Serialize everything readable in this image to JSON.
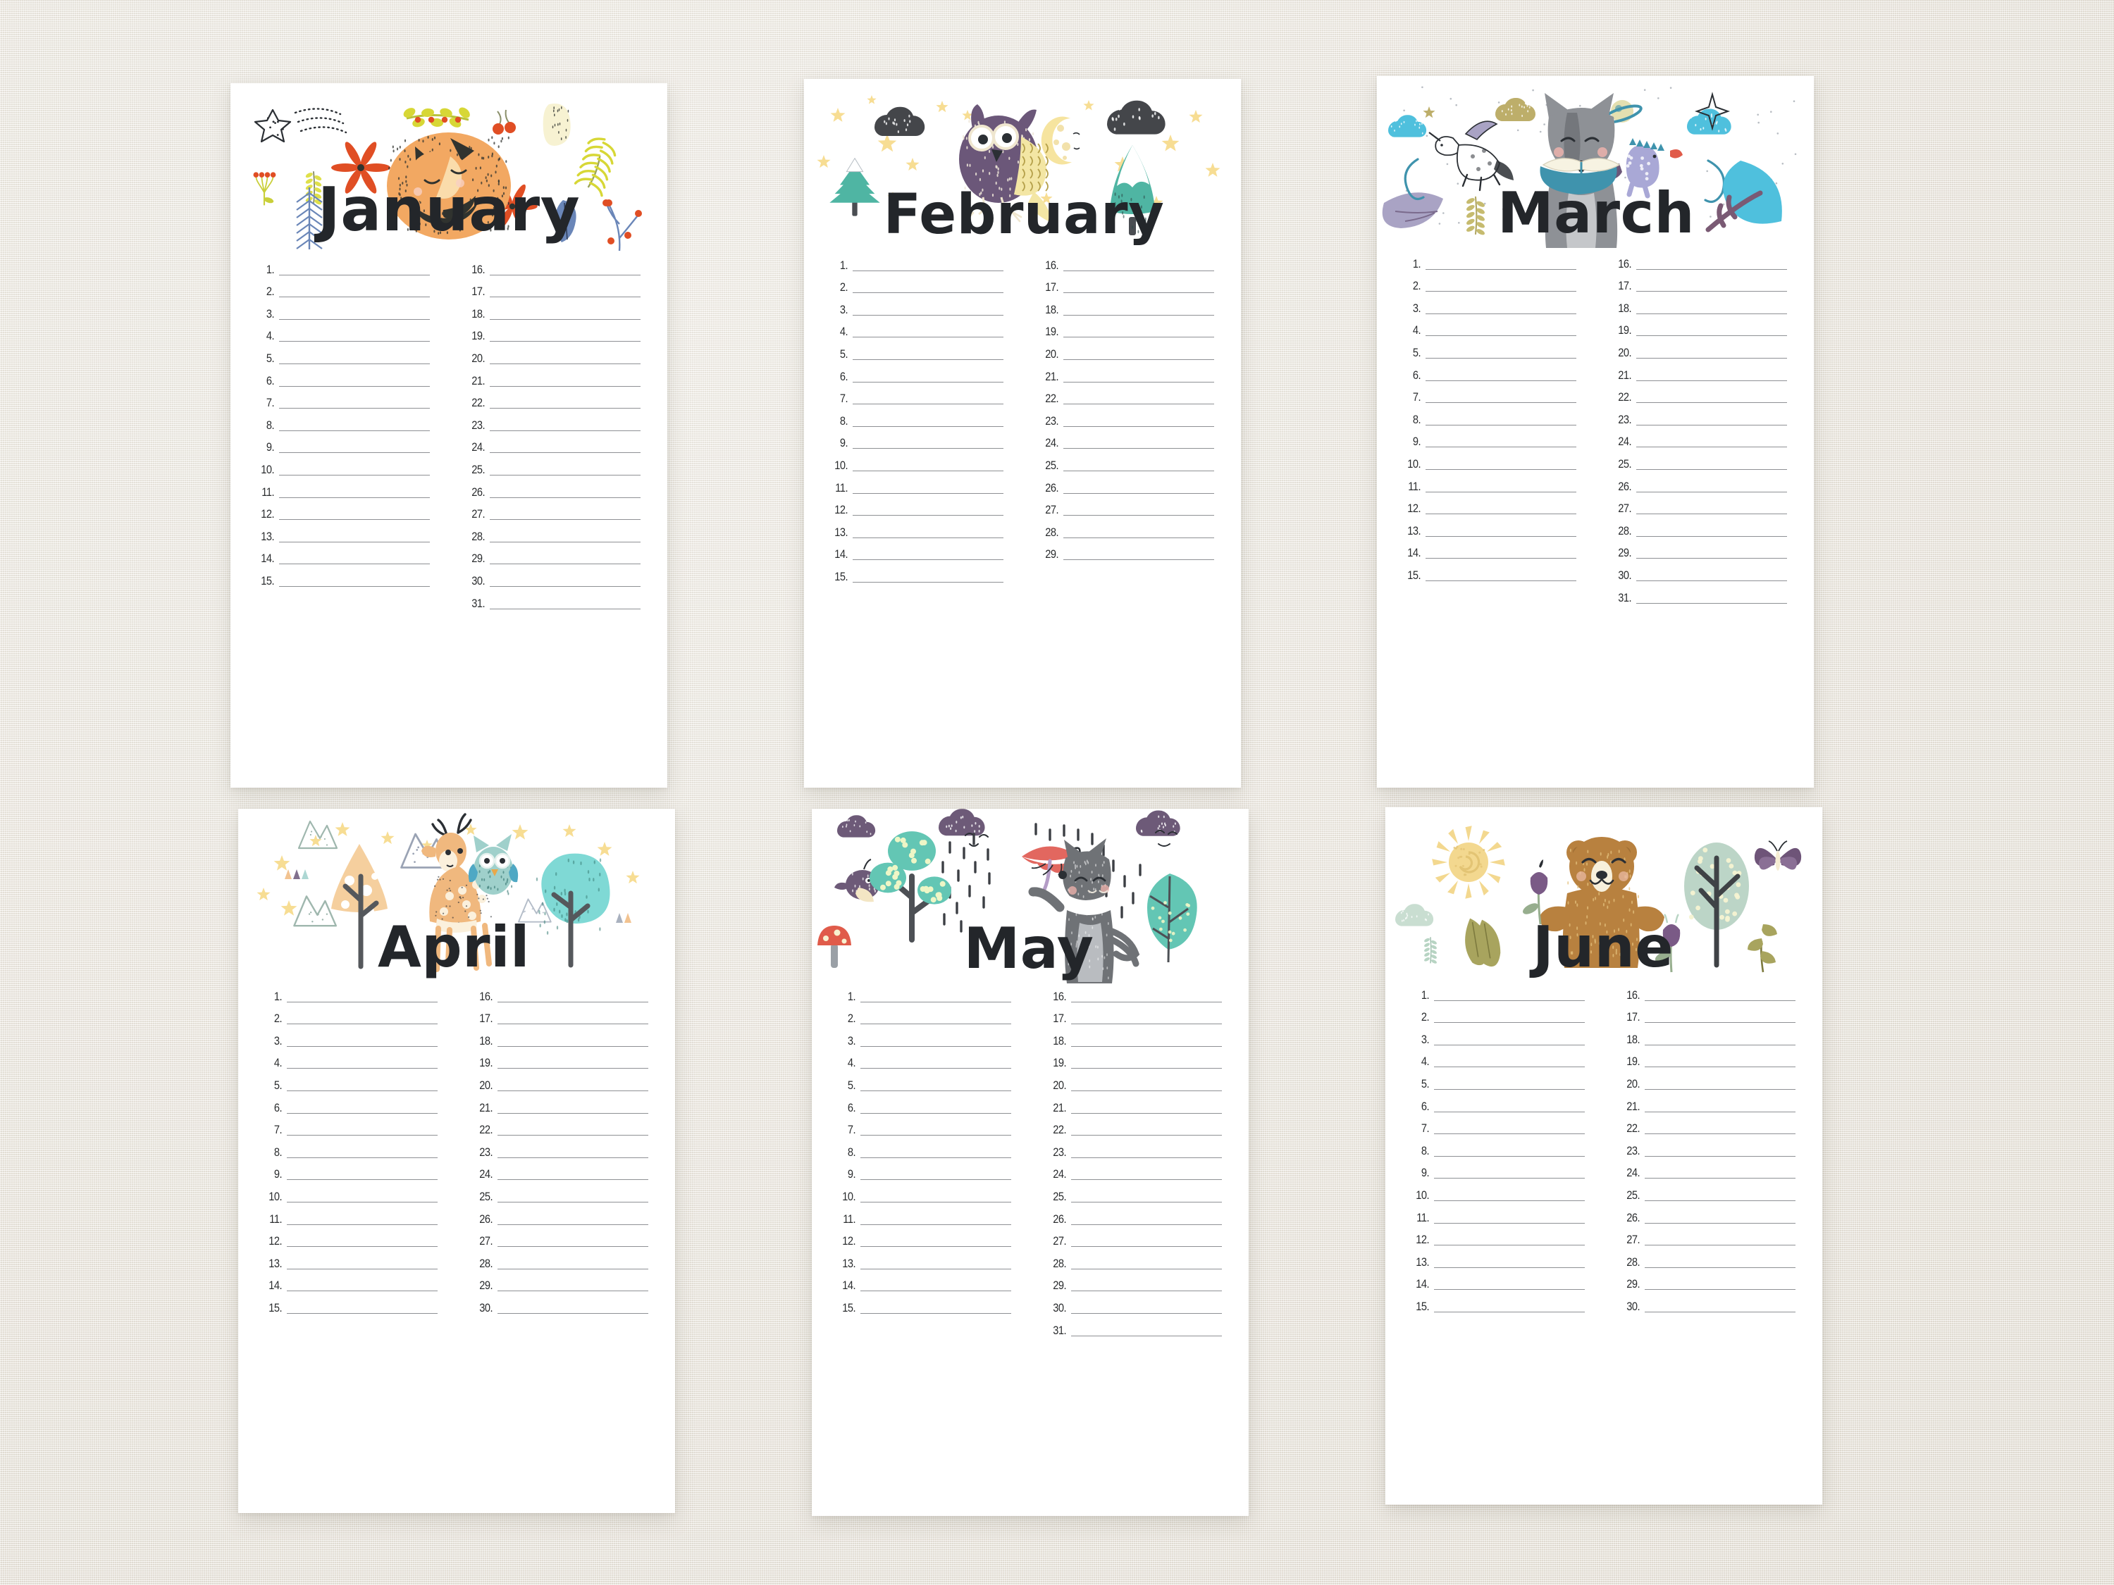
{
  "background": {
    "color": "#f1eee8",
    "texture": "linen-canvas"
  },
  "sheet": {
    "color": "#ffffff",
    "line_color": "#8e9094",
    "number_color": "#2a2c2e",
    "title_color": "#23262a"
  },
  "pages": [
    {
      "id": "january",
      "title": "January",
      "days": 31,
      "left_column": [
        "1.",
        "2.",
        "3.",
        "4.",
        "5.",
        "6.",
        "7.",
        "8.",
        "9.",
        "10.",
        "11.",
        "12.",
        "13.",
        "14.",
        "15."
      ],
      "right_column": [
        "16.",
        "17.",
        "18.",
        "19.",
        "20.",
        "21.",
        "22.",
        "23.",
        "24.",
        "25.",
        "26.",
        "27.",
        "28.",
        "29.",
        "30.",
        "31."
      ],
      "art": {
        "theme": "winter-fox",
        "palette": {
          "fox_body": "#f2a862",
          "fox_dark": "#30332f",
          "berry_red": "#e04e24",
          "leaf_yellow": "#d7d736",
          "leaf_blue": "#6a86b8",
          "cream": "#f7f2d2"
        },
        "elements": [
          "sleeping-fox-icon",
          "star-outline-icon",
          "swoosh-lines-icon",
          "yellow-berry-branch-icon",
          "red-berry-cluster-icon",
          "blue-fir-branch-icon",
          "orange-star-flower-icon",
          "cherry-berries-icon",
          "cream-leaf-icon",
          "yellow-fern-icon",
          "blue-holly-leaf-icon",
          "red-berry-twig-icon",
          "olive-leaf-sprig-icon"
        ]
      }
    },
    {
      "id": "february",
      "title": "February",
      "days": 29,
      "left_column": [
        "1.",
        "2.",
        "3.",
        "4.",
        "5.",
        "6.",
        "7.",
        "8.",
        "9.",
        "10.",
        "11.",
        "12.",
        "13.",
        "14.",
        "15."
      ],
      "right_column": [
        "16.",
        "17.",
        "18.",
        "19.",
        "20.",
        "21.",
        "22.",
        "23.",
        "24.",
        "25.",
        "26.",
        "27.",
        "28.",
        "29."
      ],
      "art": {
        "theme": "night-owl",
        "palette": {
          "owl_body": "#6b5779",
          "owl_wing": "#f3e6a4",
          "moon": "#f6e49f",
          "cloud": "#44464a",
          "tree_green": "#4fb5a3",
          "star_yellow": "#f7dd93"
        },
        "elements": [
          "flying-owl-icon",
          "crescent-moon-icon",
          "dark-cloud-icon",
          "star-icon",
          "snowy-fir-tree-icon",
          "snowy-mountain-tree-icon"
        ]
      }
    },
    {
      "id": "march",
      "title": "March",
      "days": 31,
      "left_column": [
        "1.",
        "2.",
        "3.",
        "4.",
        "5.",
        "6.",
        "7.",
        "8.",
        "9.",
        "10.",
        "11.",
        "12.",
        "13.",
        "14.",
        "15."
      ],
      "right_column": [
        "16.",
        "17.",
        "18.",
        "19.",
        "20.",
        "21.",
        "22.",
        "23.",
        "24.",
        "25.",
        "26.",
        "27.",
        "28.",
        "29.",
        "30.",
        "31."
      ],
      "art": {
        "theme": "storytime-wolf",
        "palette": {
          "wolf_grey": "#8e9196",
          "wolf_light": "#c5c7ca",
          "book_blue": "#3f93ad",
          "leaf_teal": "#4fc0dd",
          "leaf_mauve": "#a9a3c4",
          "dragon_lilac": "#a9a8d6",
          "gold": "#bdae6a"
        },
        "elements": [
          "wolf-reading-book-icon",
          "flying-unicorn-icon",
          "baby-dragon-icon",
          "planet-icon",
          "blue-cloud-icon",
          "gold-cloud-icon",
          "sparkle-star-icon",
          "mauve-leaf-icon",
          "teal-bush-icon",
          "gold-fern-icon",
          "curly-vine-icon"
        ]
      }
    },
    {
      "id": "april",
      "title": "April",
      "days": 30,
      "left_column": [
        "1.",
        "2.",
        "3.",
        "4.",
        "5.",
        "6.",
        "7.",
        "8.",
        "9.",
        "10.",
        "11.",
        "12.",
        "13.",
        "14.",
        "15."
      ],
      "right_column": [
        "16.",
        "17.",
        "18.",
        "19.",
        "20.",
        "21.",
        "22.",
        "23.",
        "24.",
        "25.",
        "26.",
        "27.",
        "28.",
        "29.",
        "30."
      ],
      "art": {
        "theme": "forest-deer",
        "palette": {
          "deer_body": "#f0b87e",
          "owl_body": "#9fd0cb",
          "tree_peach": "#f5cf9e",
          "tree_mint": "#7fd9d5",
          "star_yellow": "#f7dd93",
          "mountain_grey": "#9aa3b4"
        },
        "elements": [
          "deer-with-owl-icon",
          "peach-triangle-tree-icon",
          "mint-cloud-tree-icon",
          "mountain-outline-icon",
          "small-triangle-trees-icon",
          "star-icon"
        ]
      }
    },
    {
      "id": "may",
      "title": "May",
      "days": 31,
      "left_column": [
        "1.",
        "2.",
        "3.",
        "4.",
        "5.",
        "6.",
        "7.",
        "8.",
        "9.",
        "10.",
        "11.",
        "12.",
        "13.",
        "14.",
        "15."
      ],
      "right_column": [
        "16.",
        "17.",
        "18.",
        "19.",
        "20.",
        "21.",
        "22.",
        "23.",
        "24.",
        "25.",
        "26.",
        "27.",
        "28.",
        "29.",
        "30.",
        "31."
      ],
      "art": {
        "theme": "rainy-day-wolf",
        "palette": {
          "wolf_grey": "#6f7276",
          "umbrella_red": "#e2675f",
          "cloud_purple": "#6d5a78",
          "tree_green": "#63c6b4",
          "mushroom_red": "#e05b4a",
          "bird_purple": "#6d5a78"
        },
        "elements": [
          "wolf-with-umbrella-icon",
          "rain-cloud-icon",
          "raindrops-icon",
          "mushroom-icon",
          "purple-bird-icon",
          "apple-tree-icon",
          "green-leaf-icon"
        ]
      }
    },
    {
      "id": "june",
      "title": "June",
      "days": 30,
      "left_column": [
        "1.",
        "2.",
        "3.",
        "4.",
        "5.",
        "6.",
        "7.",
        "8.",
        "9.",
        "10.",
        "11.",
        "12.",
        "13.",
        "14.",
        "15."
      ],
      "right_column": [
        "16.",
        "17.",
        "18.",
        "19.",
        "20.",
        "21.",
        "22.",
        "23.",
        "24.",
        "25.",
        "26.",
        "27.",
        "28.",
        "29.",
        "30."
      ],
      "art": {
        "theme": "summer-bear",
        "palette": {
          "bear_brown": "#b8813f",
          "sun_yellow": "#f3d88f",
          "tree_sage": "#bcd5c7",
          "butterfly_purple": "#6e5478",
          "flower_purple": "#7a5a86",
          "leaf_olive": "#a8a45e"
        },
        "elements": [
          "standing-bear-icon",
          "sun-icon",
          "sage-tree-icon",
          "butterfly-icon",
          "purple-tulip-icon",
          "olive-leaf-icon",
          "mint-cloud-icon",
          "small-sprig-icon"
        ]
      }
    }
  ]
}
